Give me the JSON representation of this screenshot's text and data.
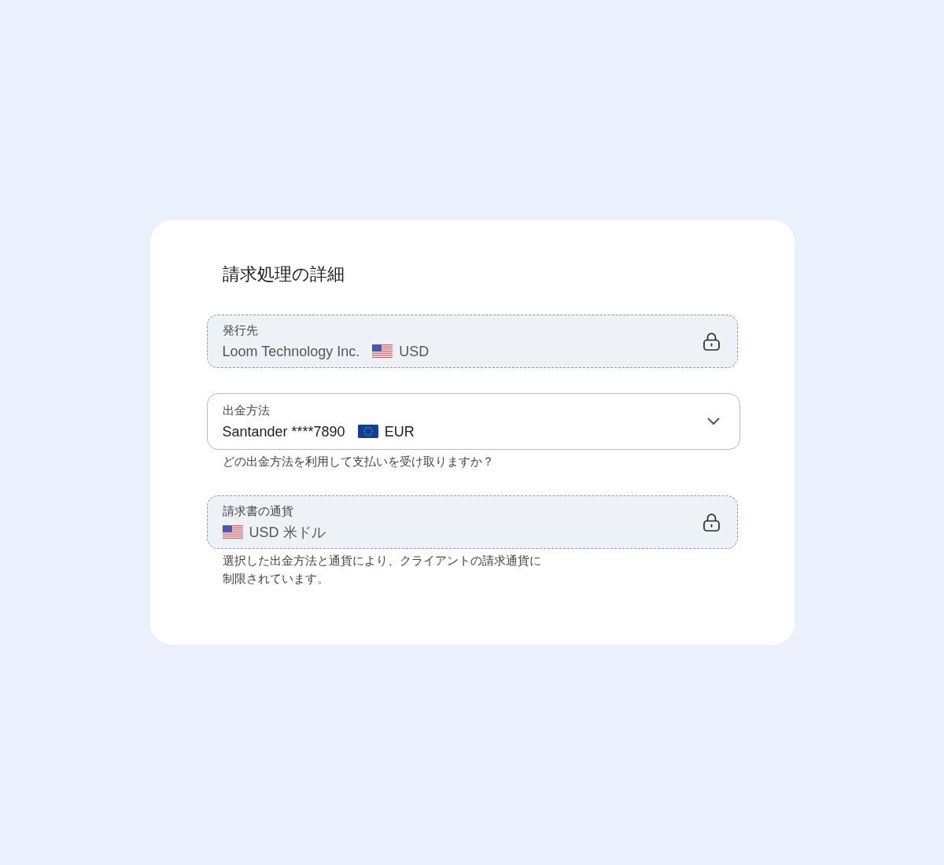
{
  "title": "請求処理の詳細",
  "fields": [
    {
      "kind": "locked",
      "label": "発行先",
      "parts": [
        {
          "kind": "text",
          "text": "Loom Technology Inc."
        },
        {
          "kind": "flag_us"
        },
        {
          "kind": "text",
          "text": "USD"
        }
      ]
    },
    {
      "kind": "select",
      "label": "出金方法",
      "parts": [
        {
          "kind": "text",
          "text": "Santander ****7890"
        },
        {
          "kind": "flag_eu"
        },
        {
          "kind": "text",
          "text": "EUR"
        }
      ],
      "helper": "どの出金方法を利用して支払いを受け取りますか？"
    },
    {
      "kind": "locked",
      "label": "請求書の通貨",
      "parts": [
        {
          "kind": "flag_us"
        },
        {
          "kind": "text",
          "text": "USD 米ドル"
        }
      ],
      "helper": "選択した出金方法と通貨により、クライアントの請求通貨に制限されています。"
    }
  ]
}
